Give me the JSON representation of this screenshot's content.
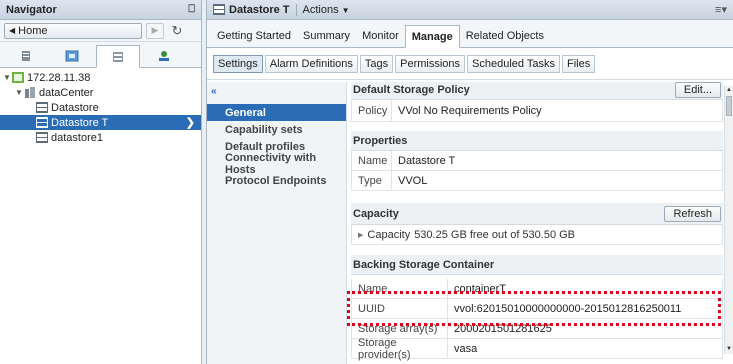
{
  "navigator": {
    "title": "Navigator",
    "home_label": "Home",
    "tree": [
      {
        "label": "172.28.11.38"
      },
      {
        "label": "dataCenter"
      },
      {
        "label": "Datastore"
      },
      {
        "label": "Datastore T"
      },
      {
        "label": "datastore1"
      }
    ]
  },
  "main": {
    "object_title": "Datastore T",
    "actions_label": "Actions",
    "tabs": [
      "Getting Started",
      "Summary",
      "Monitor",
      "Manage",
      "Related Objects"
    ],
    "sub_tabs": [
      "Settings",
      "Alarm Definitions",
      "Tags",
      "Permissions",
      "Scheduled Tasks",
      "Files"
    ],
    "left_nav": [
      "General",
      "Capability sets",
      "Default profiles",
      "Connectivity with Hosts",
      "Protocol Endpoints"
    ],
    "default_storage_policy": {
      "title": "Default Storage Policy",
      "edit_label": "Edit...",
      "key": "Policy",
      "value": "VVol No Requirements Policy"
    },
    "properties": {
      "title": "Properties",
      "rows": [
        {
          "k": "Name",
          "v": "Datastore T"
        },
        {
          "k": "Type",
          "v": "VVOL"
        }
      ]
    },
    "capacity": {
      "title": "Capacity",
      "refresh_label": "Refresh",
      "key": "Capacity",
      "value": "530.25 GB free out of 530.50 GB"
    },
    "backing_storage": {
      "title": "Backing Storage Container",
      "rows": [
        {
          "k": "Name",
          "v": "containerT"
        },
        {
          "k": "UUID",
          "v": "vvol:62015010000000000-2015012816250011"
        },
        {
          "k": "Storage array(s)",
          "v": "2000201501281625"
        },
        {
          "k": "Storage provider(s)",
          "v": "vasa"
        }
      ]
    }
  },
  "colors": {
    "selection": "#2a6cb5",
    "highlight_border": "#e0001b"
  }
}
